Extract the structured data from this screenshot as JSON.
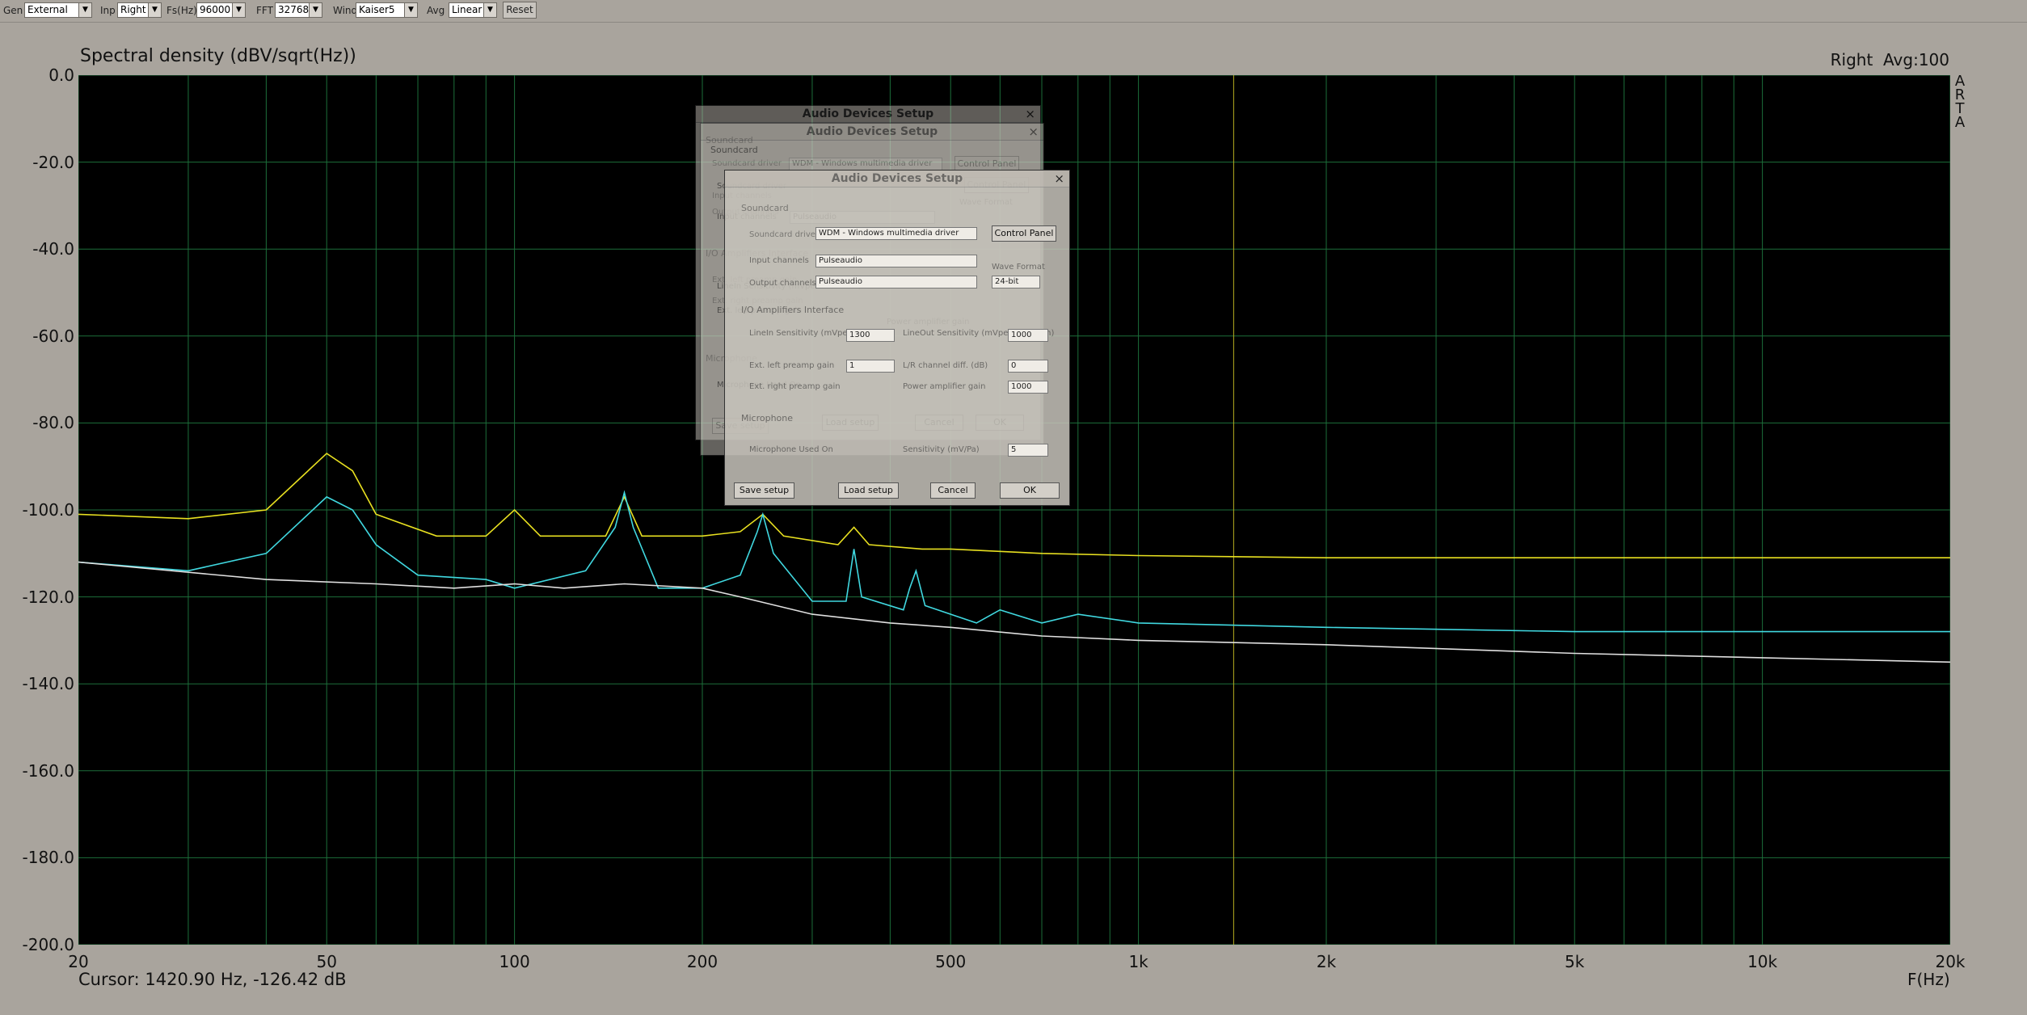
{
  "toolbar": {
    "gen_label": "Gen",
    "gen_value": "External",
    "inp_label": "Inp",
    "inp_value": "Right",
    "fs_label": "Fs(Hz)",
    "fs_value": "96000",
    "fft_label": "FFT",
    "fft_value": "32768",
    "wind_label": "Wind",
    "wind_value": "Kaiser5",
    "avg_label": "Avg",
    "avg_value": "Linear",
    "reset_label": "Reset"
  },
  "chart": {
    "title": "Spectral density (dBV/sqrt(Hz))",
    "channel": "Right",
    "avg": "Avg:100",
    "side_logo": [
      "A",
      "R",
      "T",
      "A"
    ],
    "cursor": "Cursor: 1420.90 Hz, -126.42 dB",
    "x_unit": "F(Hz)"
  },
  "chart_data": {
    "type": "line",
    "x_scale": "log",
    "xlim": [
      20,
      20000
    ],
    "ylim": [
      -200,
      0
    ],
    "grid": true,
    "yticks": [
      "0.0",
      "-20.0",
      "-40.0",
      "-60.0",
      "-80.0",
      "-100.0",
      "-120.0",
      "-140.0",
      "-160.0",
      "-180.0",
      "-200.0"
    ],
    "xticks": [
      {
        "v": 20,
        "label": "20"
      },
      {
        "v": 50,
        "label": "50"
      },
      {
        "v": 100,
        "label": "100"
      },
      {
        "v": 200,
        "label": "200"
      },
      {
        "v": 500,
        "label": "500"
      },
      {
        "v": 1000,
        "label": "1k"
      },
      {
        "v": 2000,
        "label": "2k"
      },
      {
        "v": 5000,
        "label": "5k"
      },
      {
        "v": 10000,
        "label": "10k"
      },
      {
        "v": 20000,
        "label": "20k"
      }
    ],
    "cursor_freq": 1420.9,
    "series": [
      {
        "color": "#e8e020",
        "points": [
          [
            20,
            -101
          ],
          [
            30,
            -102
          ],
          [
            40,
            -100
          ],
          [
            50,
            -87
          ],
          [
            55,
            -91
          ],
          [
            60,
            -101
          ],
          [
            75,
            -106
          ],
          [
            90,
            -106
          ],
          [
            100,
            -100
          ],
          [
            110,
            -106
          ],
          [
            140,
            -106
          ],
          [
            150,
            -97
          ],
          [
            160,
            -106
          ],
          [
            200,
            -106
          ],
          [
            230,
            -105
          ],
          [
            250,
            -101
          ],
          [
            270,
            -106
          ],
          [
            330,
            -108
          ],
          [
            350,
            -104
          ],
          [
            370,
            -108
          ],
          [
            450,
            -109
          ],
          [
            500,
            -109
          ],
          [
            700,
            -110
          ],
          [
            1000,
            -110.5
          ],
          [
            2000,
            -111
          ],
          [
            5000,
            -111
          ],
          [
            10000,
            -111
          ],
          [
            20000,
            -111
          ]
        ]
      },
      {
        "color": "#40d8e0",
        "points": [
          [
            20,
            -112
          ],
          [
            30,
            -114
          ],
          [
            40,
            -110
          ],
          [
            50,
            -97
          ],
          [
            55,
            -100
          ],
          [
            60,
            -108
          ],
          [
            70,
            -115
          ],
          [
            90,
            -116
          ],
          [
            100,
            -118
          ],
          [
            130,
            -114
          ],
          [
            145,
            -104
          ],
          [
            150,
            -96
          ],
          [
            155,
            -104
          ],
          [
            170,
            -118
          ],
          [
            200,
            -118
          ],
          [
            230,
            -115
          ],
          [
            245,
            -105
          ],
          [
            250,
            -101
          ],
          [
            260,
            -110
          ],
          [
            300,
            -121
          ],
          [
            340,
            -121
          ],
          [
            350,
            -109
          ],
          [
            360,
            -120
          ],
          [
            420,
            -123
          ],
          [
            430,
            -118
          ],
          [
            440,
            -114
          ],
          [
            455,
            -122
          ],
          [
            550,
            -126
          ],
          [
            600,
            -123
          ],
          [
            700,
            -126
          ],
          [
            800,
            -124
          ],
          [
            1000,
            -126
          ],
          [
            2000,
            -127
          ],
          [
            5000,
            -128
          ],
          [
            10000,
            -128
          ],
          [
            20000,
            -128
          ]
        ]
      },
      {
        "color": "#e0e0e0",
        "points": [
          [
            20,
            -112
          ],
          [
            40,
            -116
          ],
          [
            60,
            -117
          ],
          [
            80,
            -118
          ],
          [
            100,
            -117
          ],
          [
            120,
            -118
          ],
          [
            150,
            -117
          ],
          [
            200,
            -118
          ],
          [
            230,
            -120
          ],
          [
            300,
            -124
          ],
          [
            400,
            -126
          ],
          [
            500,
            -127
          ],
          [
            700,
            -129
          ],
          [
            1000,
            -130
          ],
          [
            2000,
            -131
          ],
          [
            5000,
            -133
          ],
          [
            10000,
            -134
          ],
          [
            20000,
            -135
          ]
        ]
      }
    ]
  },
  "dialogs": {
    "title": "Audio Devices Setup",
    "soundcard": "Soundcard",
    "driver_label": "Soundcard driver",
    "driver_value": "WDM - Windows multimedia driver",
    "control_panel": "Control Panel",
    "input_label": "Input channels",
    "input_value": "Pulseaudio",
    "output_label": "Output channels",
    "output_value": "Pulseaudio",
    "wave_format": "Wave Format",
    "wave_value": "24-bit",
    "amp": "I/O Amplifiers Interface",
    "linein_label": "LineIn Sensitivity (mVpeak - left ch)",
    "linein_value": "1300",
    "lineout_label": "LineOut Sensitivity (mVpeak - left ch)",
    "lineout_value": "1000",
    "preamp_label": "Ext. left preamp gain",
    "preamp_value": "1",
    "lr_label": "L/R channel diff. (dB)",
    "lr_value": "0",
    "rpreamp_label": "Ext. right preamp gain",
    "power_label": "Power amplifier gain",
    "power_value": "1000",
    "microphone": "Microphone",
    "mic_used": "Microphone Used On",
    "mic_sens": "Sensitivity (mV/Pa)",
    "mic_sens_value": "5",
    "save": "Save setup",
    "load": "Load setup",
    "cancel": "Cancel",
    "ok": "OK",
    "close": "×"
  }
}
